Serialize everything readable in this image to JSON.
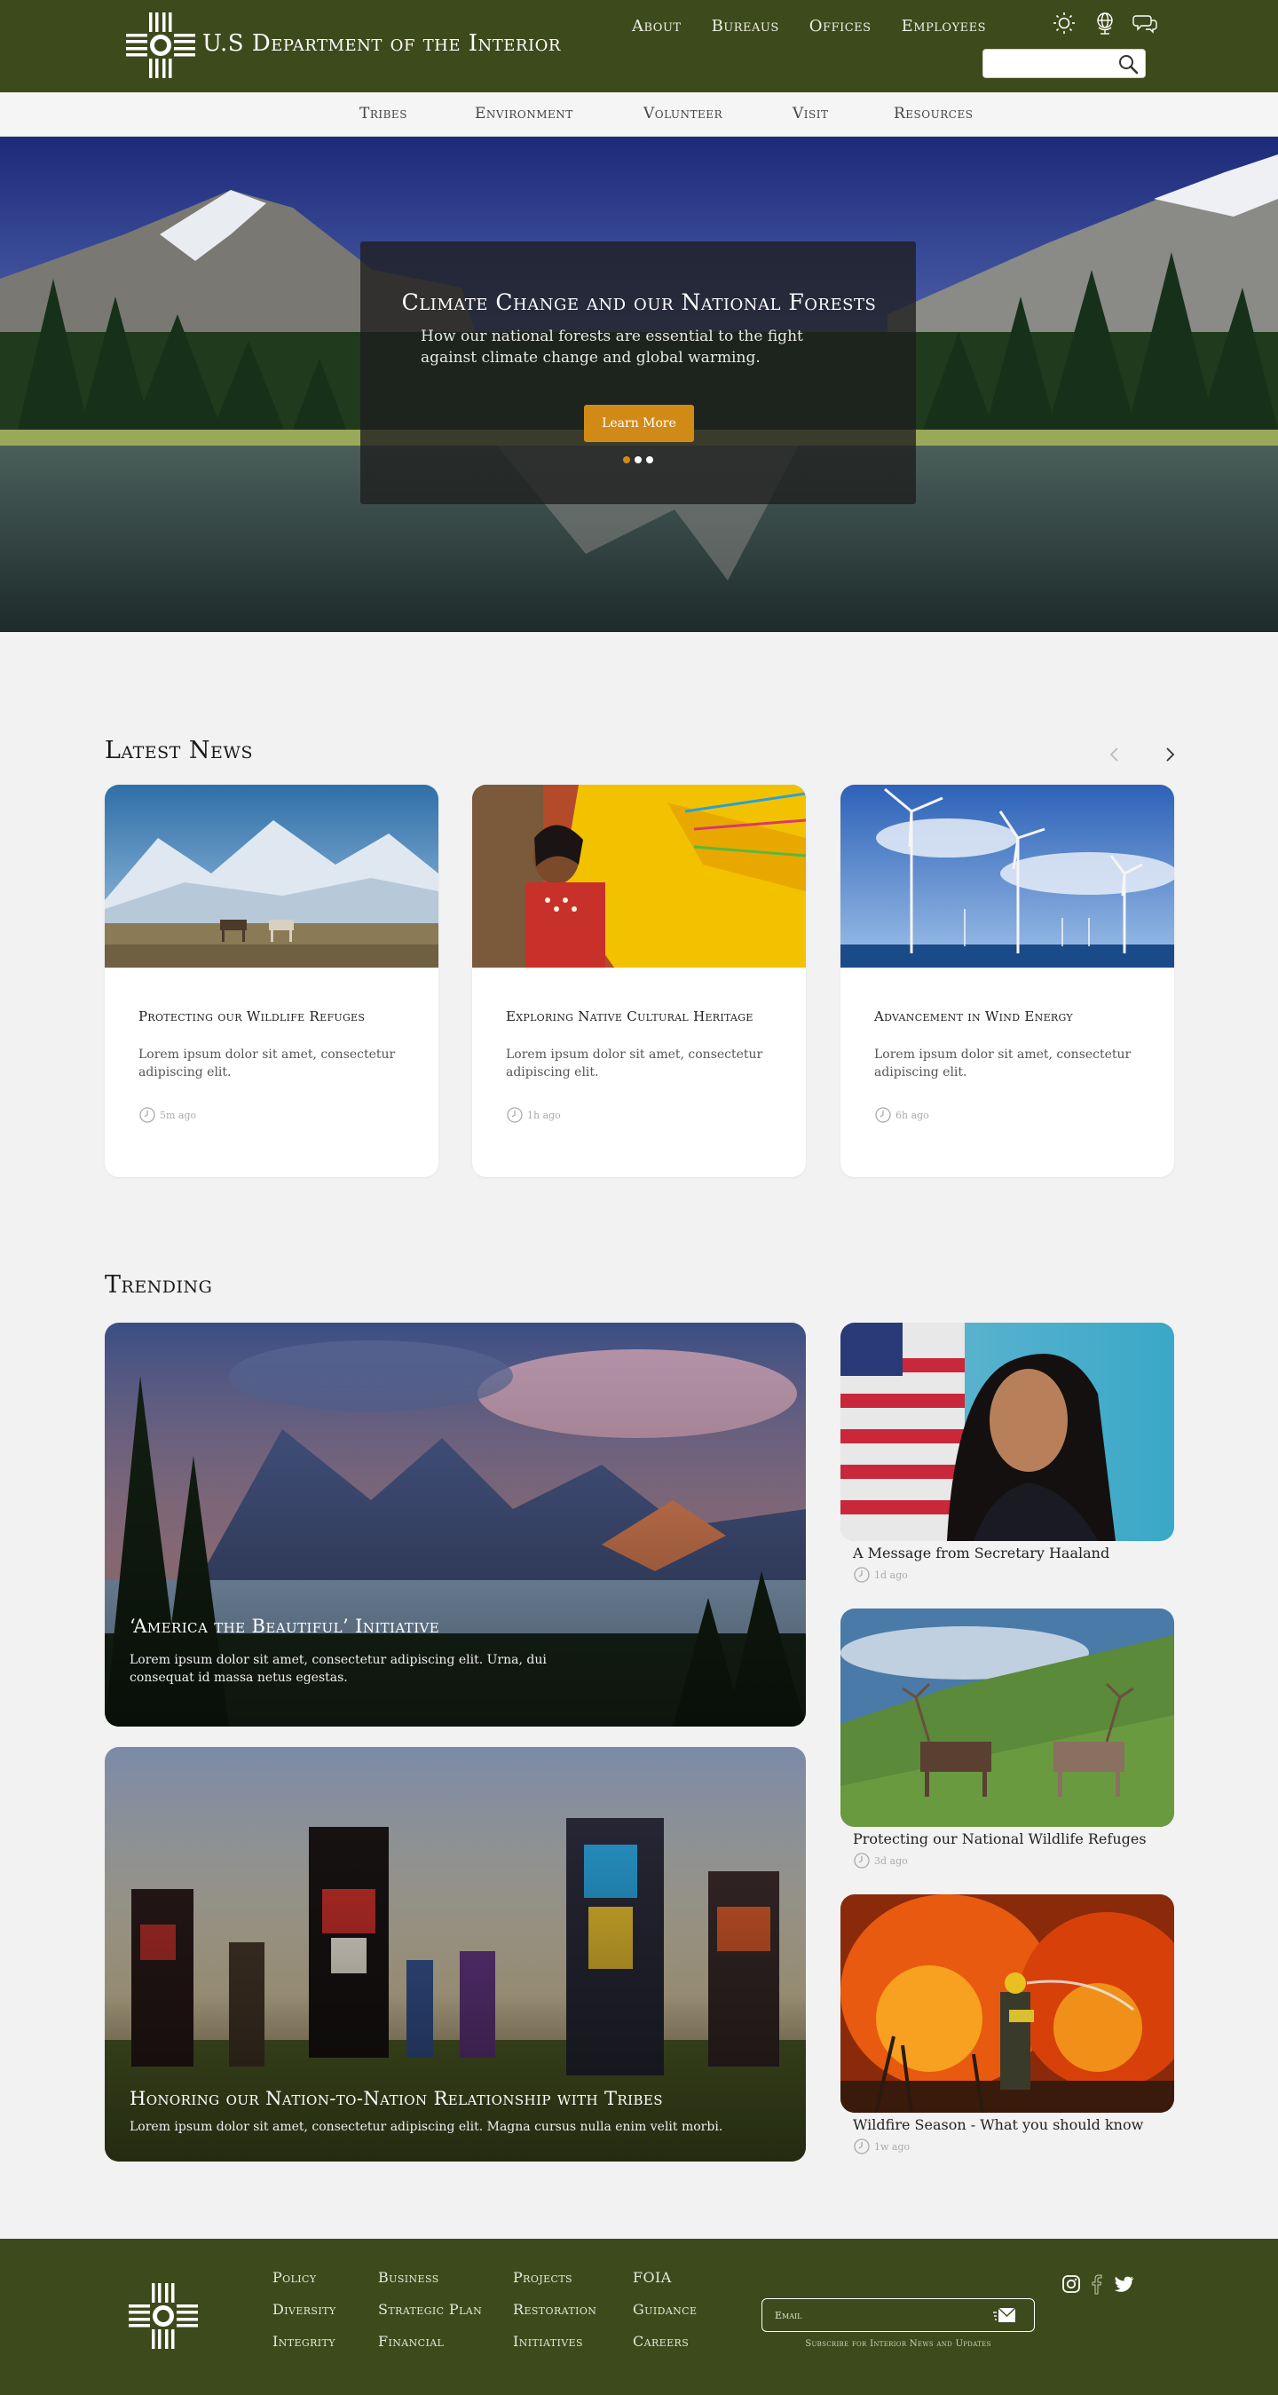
{
  "header": {
    "site_title": "U.S Department of the Interior",
    "nav": [
      "About",
      "Bureaus",
      "Offices",
      "Employees"
    ],
    "utility_icons": [
      "brightness-icon",
      "globe-icon",
      "chat-icon"
    ],
    "search": {
      "placeholder": "",
      "value": ""
    }
  },
  "subnav": [
    "Tribes",
    "Environment",
    "Volunteer",
    "Visit",
    "Resources"
  ],
  "hero": {
    "title": "Climate Change and our National Forests",
    "subtitle": "How our national forests are essential to the fight against climate change and global warming.",
    "button": "Learn More",
    "slides": 3,
    "active_slide": 0
  },
  "latest_news": {
    "title": "Latest News",
    "items": [
      {
        "title": "Protecting our Wildlife Refuges",
        "desc": "Lorem ipsum dolor sit amet, consectetur adipiscing elit.",
        "time": "5m ago"
      },
      {
        "title": "Exploring Native Cultural Heritage",
        "desc": "Lorem ipsum dolor sit amet, consectetur adipiscing elit.",
        "time": "1h ago"
      },
      {
        "title": "Advancement in Wind Energy",
        "desc": "Lorem ipsum dolor sit amet, consectetur adipiscing elit.",
        "time": "6h ago"
      }
    ]
  },
  "trending": {
    "title": "Trending",
    "featured": [
      {
        "title": "‘America the Beautiful’ Initiative",
        "desc": "Lorem ipsum dolor sit amet, consectetur adipiscing elit. Urna, dui consequat id massa netus egestas."
      },
      {
        "title": "Honoring our Nation-to-Nation Relationship with Tribes",
        "desc": "Lorem ipsum dolor sit amet, consectetur adipiscing elit. Magna cursus nulla enim velit morbi."
      }
    ],
    "side": [
      {
        "title": "A Message from Secretary Haaland",
        "time": "1d ago"
      },
      {
        "title": "Protecting our National Wildlife Refuges",
        "time": "3d ago"
      },
      {
        "title": "Wildfire  Season - What you should know",
        "time": "1w ago"
      }
    ]
  },
  "footer": {
    "columns": [
      [
        "Policy",
        "Diversity",
        "Integrity"
      ],
      [
        "Business",
        "Strategic Plan",
        "Financial"
      ],
      [
        "Projects",
        "Restoration",
        "Initiatives"
      ],
      [
        "FOIA",
        "Guidance",
        "Careers"
      ]
    ],
    "email_placeholder": "Email",
    "subscribe_text": "Subscribe for Interior News and Updates",
    "social": [
      "instagram-icon",
      "facebook-icon",
      "twitter-icon"
    ]
  },
  "colors": {
    "header_green": "#3d4a1b",
    "accent_orange": "#d28a16",
    "page_bg": "#f2f2f2"
  }
}
